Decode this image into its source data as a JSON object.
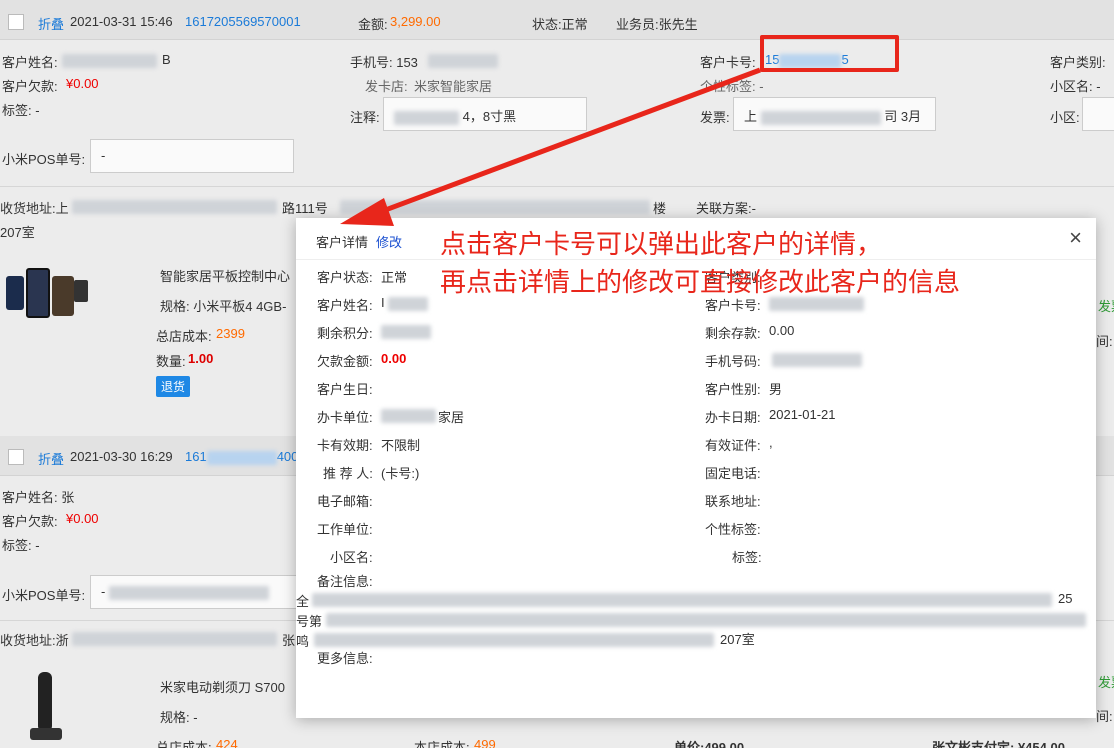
{
  "orders": [
    {
      "fold_label": "折叠",
      "datetime": "2021-03-31 15:46",
      "order_no": "1617205569570001",
      "amount_label": "金额:",
      "amount": "3,299.00",
      "status": "状态:正常",
      "salesman": "业务员:张先生",
      "customer_name_label": "客户姓名:",
      "customer_name_tail": "B",
      "phone_label": "手机号: 153",
      "card_label": "客户卡号:",
      "card_head": "15",
      "card_tail": "5",
      "category_label": "客户类别:",
      "debt_label": "客户欠款:",
      "debt": "¥0.00",
      "issue_store_label": "发卡店:",
      "issue_store": "米家智能家居",
      "tag_personal_label": "个性标签: -",
      "district_label": "小区名: -",
      "tags_label": "标签: -",
      "remark_label": "注释:",
      "remark_value_tail": "4，8寸黑",
      "invoice_label": "发票:",
      "invoice_head": "上",
      "invoice_tail": "司 3月",
      "district2_label": "小区:",
      "pos_label": "小米POS单号:",
      "pos_value": "-",
      "address_label": "收货地址:上",
      "address_mid": "路111号",
      "address_mid2": "楼",
      "address_line2": "207室",
      "related_plan": "关联方案:-",
      "product_name": "智能家居平板控制中心",
      "product_spec": "规格: 小米平板4 4GB-",
      "store_cost_label": "总店成本:",
      "store_cost": "2399",
      "qty_label": "数量:",
      "qty": "1.00",
      "return_btn": "退货",
      "side_right1": "发票",
      "side_right2": "间:"
    },
    {
      "fold_label": "折叠",
      "datetime": "2021-03-30 16:29",
      "order_no_head": "161",
      "order_no_tail": "400",
      "customer_name_label": "客户姓名: 张",
      "debt_label": "客户欠款:",
      "debt": "¥0.00",
      "tags_label": "标签: -",
      "pos_label": "小米POS单号:",
      "pos_value": "-",
      "address_label": "收货地址:浙",
      "address_mid": "张",
      "product_name": "米家电动剃须刀 S700",
      "product_spec": "规格: -",
      "store_cost_label": "总店成本:",
      "store_cost": "424",
      "branch_cost_label": "本店成本:",
      "branch_cost": "499",
      "unit_price": "单价:499.00",
      "paid": "张文彬支付定: ¥454.00",
      "side_right1": "发票",
      "side_right2": "间:"
    }
  ],
  "modal": {
    "title": "客户详情",
    "edit_label": "修改",
    "close_label": "×",
    "left": [
      {
        "label": "客户状态:",
        "value": "正常"
      },
      {
        "label": "客户姓名:",
        "value": "I"
      },
      {
        "label": "剩余积分:",
        "value": ""
      },
      {
        "label": "欠款金额:",
        "value": "0.00"
      },
      {
        "label": "客户生日:",
        "value": ""
      },
      {
        "label": "办卡单位:",
        "value": "家居"
      },
      {
        "label": "卡有效期:",
        "value": "不限制"
      },
      {
        "label": "推 荐 人:",
        "value": "(卡号:)"
      },
      {
        "label": "电子邮箱:",
        "value": ""
      },
      {
        "label": "工作单位:",
        "value": ""
      },
      {
        "label": "小区名:",
        "value": ""
      },
      {
        "label": "备注信息:",
        "value": ""
      }
    ],
    "right": [
      {
        "label": "客户类别:",
        "value": ""
      },
      {
        "label": "客户卡号:",
        "value": ""
      },
      {
        "label": "剩余存款:",
        "value": "0.00"
      },
      {
        "label": "手机号码:",
        "value": ""
      },
      {
        "label": "客户性别:",
        "value": "男"
      },
      {
        "label": "办卡日期:",
        "value": "2021-01-21"
      },
      {
        "label": "有效证件:",
        "value": ","
      },
      {
        "label": "固定电话:",
        "value": ""
      },
      {
        "label": "联系地址:",
        "value": ""
      },
      {
        "label": "个性标签:",
        "value": ""
      },
      {
        "label": "标签:",
        "value": ""
      }
    ],
    "remark_line1_head": "全",
    "remark_line1_tail": "25",
    "remark_line2_head": "号第",
    "remark_line2_mid": "207室...",
    "remark_line3_head": "鸣",
    "remark_line3_tail": "207室",
    "more_info_label": "更多信息:"
  },
  "annotation": {
    "line1": "点击客户卡号可以弹出此客户的详情，",
    "line2": "再点击详情上的修改可直接修改此客户的信息",
    "color": "#e8261b"
  }
}
